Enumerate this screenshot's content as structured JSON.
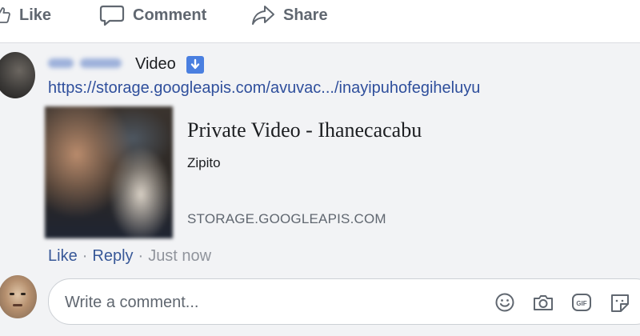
{
  "actions": {
    "like_label": "Like",
    "comment_label": "Comment",
    "share_label": "Share"
  },
  "post": {
    "type_label": "Video",
    "url": "https://storage.googleapis.com/avuvac.../inayipuhofegiheluyu",
    "preview": {
      "title": "Private Video - Ihanecacabu",
      "description": "Zipito",
      "domain": "STORAGE.GOOGLEAPIS.COM"
    },
    "meta": {
      "like_label": "Like",
      "reply_label": "Reply",
      "separator": "·",
      "timestamp": "Just now"
    }
  },
  "composer": {
    "placeholder": "Write a comment...",
    "value": "",
    "icons": [
      "emoji-icon",
      "camera-icon",
      "gif-icon",
      "sticker-icon"
    ]
  },
  "colors": {
    "link": "#385898",
    "url": "#2f4f9c",
    "muted": "#90949c",
    "action_gray": "#606770",
    "badge_blue": "#4a7fe0"
  }
}
